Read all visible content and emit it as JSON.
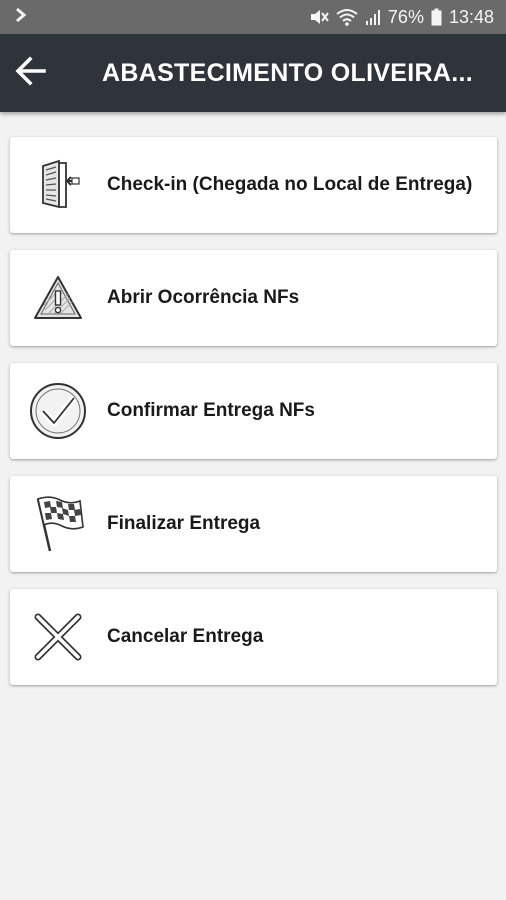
{
  "status_bar": {
    "battery": "76%",
    "time": "13:48",
    "icons": [
      "chevron-right-icon",
      "mute-icon",
      "wifi-icon",
      "signal-icon",
      "battery-icon"
    ]
  },
  "app_bar": {
    "title": "ABASTECIMENTO OLIVEIRA...",
    "back_icon": "arrow-left-icon",
    "background": "#2f343b"
  },
  "menu": {
    "items": [
      {
        "label": "Check-in (Chegada no Local de Entrega)",
        "icon": "door-checkin-icon"
      },
      {
        "label": "Abrir Ocorrência NFs",
        "icon": "warning-icon"
      },
      {
        "label": "Confirmar Entrega NFs",
        "icon": "checkmark-circle-icon"
      },
      {
        "label": "Finalizar Entrega",
        "icon": "checkered-flag-icon"
      },
      {
        "label": "Cancelar Entrega",
        "icon": "x-cross-icon"
      }
    ]
  }
}
